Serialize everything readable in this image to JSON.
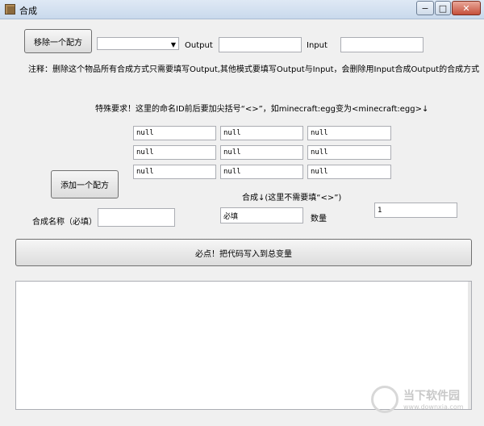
{
  "window": {
    "title": "合成",
    "icon": "crafting-table-icon",
    "minimize": "−",
    "maximize": "□",
    "close": "✕"
  },
  "remove": {
    "button": "移除一个配方",
    "select_value": "",
    "output_label": "Output",
    "output_value": "",
    "input_label": "Input",
    "input_value": ""
  },
  "note": "注释：删除这个物品所有合成方式只需要填写Output,其他模式要填写Output与Input，会删除用Input合成Output的合成方式",
  "special": "特殊要求！这里的命名ID前后要加尖括号“<>”，如minecraft:egg变为<minecraft:egg>↓",
  "grid": [
    [
      "null",
      "null",
      "null"
    ],
    [
      "null",
      "null",
      "null"
    ],
    [
      "null",
      "null",
      "null"
    ]
  ],
  "add": {
    "button": "添加一个配方",
    "result_label": "合成↓(这里不需要填“<>”)",
    "name_label": "合成名称（必填）",
    "name_value": "",
    "result_value": "必填",
    "count_label": "数量",
    "count_value": "1"
  },
  "write_button": "必点！把代码写入到总变量",
  "output_text": "",
  "watermark": {
    "text": "当下软件园",
    "url": "www.downxia.com"
  }
}
